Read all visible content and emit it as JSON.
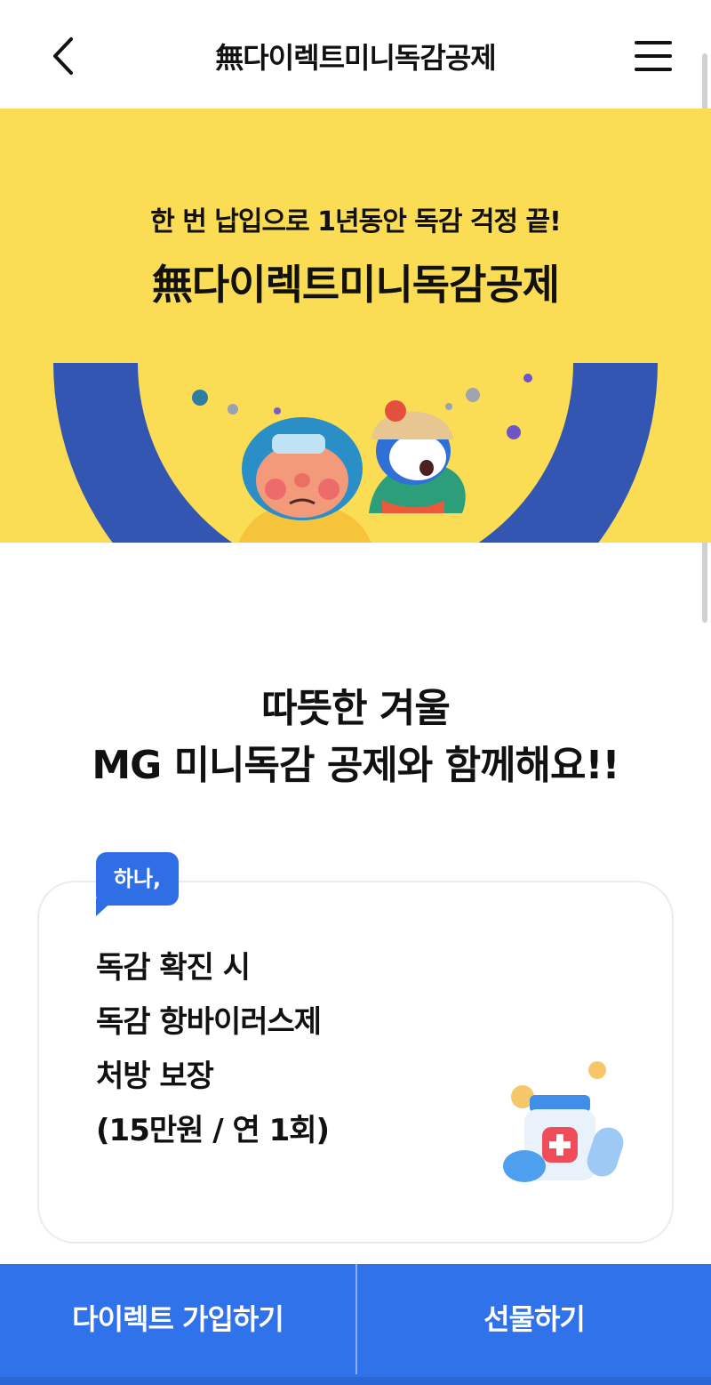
{
  "header": {
    "title": "無다이렉트미니독감공제",
    "back_icon": "chevron-left-icon",
    "menu_icon": "hamburger-menu-icon"
  },
  "hero": {
    "subtitle": "한 번 납입으로 1년동안 독감 걱정 끝!",
    "title": "無다이렉트미니독감공제",
    "background_color": "#fbdd55",
    "arc_color": "#3456b3"
  },
  "headline": {
    "line1": "따뜻한 겨울",
    "line2": "MG 미니독감 공제와 함께해요!!"
  },
  "benefit_card": {
    "badge": "하나,",
    "lines": [
      "독감 확진 시",
      "독감 항바이러스제",
      "처방 보장",
      "(15만원 / 연 1회)"
    ],
    "illustration": "medicine-bottle-icon"
  },
  "footer": {
    "primary_label": "다이렉트 가입하기",
    "secondary_label": "선물하기",
    "color": "#3072ea"
  }
}
